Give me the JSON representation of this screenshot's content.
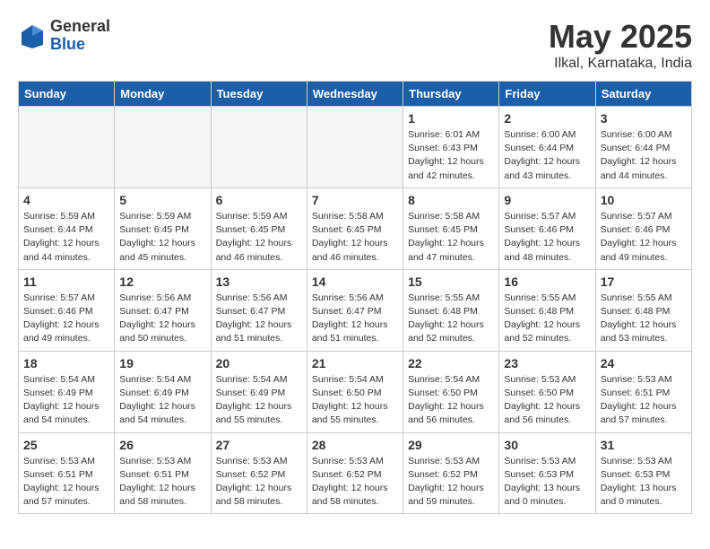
{
  "header": {
    "logo_general": "General",
    "logo_blue": "Blue",
    "month_year": "May 2025",
    "location": "Ilkal, Karnataka, India"
  },
  "days_of_week": [
    "Sunday",
    "Monday",
    "Tuesday",
    "Wednesday",
    "Thursday",
    "Friday",
    "Saturday"
  ],
  "weeks": [
    [
      {
        "day": "",
        "info": ""
      },
      {
        "day": "",
        "info": ""
      },
      {
        "day": "",
        "info": ""
      },
      {
        "day": "",
        "info": ""
      },
      {
        "day": "1",
        "info": "Sunrise: 6:01 AM\nSunset: 6:43 PM\nDaylight: 12 hours\nand 42 minutes."
      },
      {
        "day": "2",
        "info": "Sunrise: 6:00 AM\nSunset: 6:44 PM\nDaylight: 12 hours\nand 43 minutes."
      },
      {
        "day": "3",
        "info": "Sunrise: 6:00 AM\nSunset: 6:44 PM\nDaylight: 12 hours\nand 44 minutes."
      }
    ],
    [
      {
        "day": "4",
        "info": "Sunrise: 5:59 AM\nSunset: 6:44 PM\nDaylight: 12 hours\nand 44 minutes."
      },
      {
        "day": "5",
        "info": "Sunrise: 5:59 AM\nSunset: 6:45 PM\nDaylight: 12 hours\nand 45 minutes."
      },
      {
        "day": "6",
        "info": "Sunrise: 5:59 AM\nSunset: 6:45 PM\nDaylight: 12 hours\nand 46 minutes."
      },
      {
        "day": "7",
        "info": "Sunrise: 5:58 AM\nSunset: 6:45 PM\nDaylight: 12 hours\nand 46 minutes."
      },
      {
        "day": "8",
        "info": "Sunrise: 5:58 AM\nSunset: 6:45 PM\nDaylight: 12 hours\nand 47 minutes."
      },
      {
        "day": "9",
        "info": "Sunrise: 5:57 AM\nSunset: 6:46 PM\nDaylight: 12 hours\nand 48 minutes."
      },
      {
        "day": "10",
        "info": "Sunrise: 5:57 AM\nSunset: 6:46 PM\nDaylight: 12 hours\nand 49 minutes."
      }
    ],
    [
      {
        "day": "11",
        "info": "Sunrise: 5:57 AM\nSunset: 6:46 PM\nDaylight: 12 hours\nand 49 minutes."
      },
      {
        "day": "12",
        "info": "Sunrise: 5:56 AM\nSunset: 6:47 PM\nDaylight: 12 hours\nand 50 minutes."
      },
      {
        "day": "13",
        "info": "Sunrise: 5:56 AM\nSunset: 6:47 PM\nDaylight: 12 hours\nand 51 minutes."
      },
      {
        "day": "14",
        "info": "Sunrise: 5:56 AM\nSunset: 6:47 PM\nDaylight: 12 hours\nand 51 minutes."
      },
      {
        "day": "15",
        "info": "Sunrise: 5:55 AM\nSunset: 6:48 PM\nDaylight: 12 hours\nand 52 minutes."
      },
      {
        "day": "16",
        "info": "Sunrise: 5:55 AM\nSunset: 6:48 PM\nDaylight: 12 hours\nand 52 minutes."
      },
      {
        "day": "17",
        "info": "Sunrise: 5:55 AM\nSunset: 6:48 PM\nDaylight: 12 hours\nand 53 minutes."
      }
    ],
    [
      {
        "day": "18",
        "info": "Sunrise: 5:54 AM\nSunset: 6:49 PM\nDaylight: 12 hours\nand 54 minutes."
      },
      {
        "day": "19",
        "info": "Sunrise: 5:54 AM\nSunset: 6:49 PM\nDaylight: 12 hours\nand 54 minutes."
      },
      {
        "day": "20",
        "info": "Sunrise: 5:54 AM\nSunset: 6:49 PM\nDaylight: 12 hours\nand 55 minutes."
      },
      {
        "day": "21",
        "info": "Sunrise: 5:54 AM\nSunset: 6:50 PM\nDaylight: 12 hours\nand 55 minutes."
      },
      {
        "day": "22",
        "info": "Sunrise: 5:54 AM\nSunset: 6:50 PM\nDaylight: 12 hours\nand 56 minutes."
      },
      {
        "day": "23",
        "info": "Sunrise: 5:53 AM\nSunset: 6:50 PM\nDaylight: 12 hours\nand 56 minutes."
      },
      {
        "day": "24",
        "info": "Sunrise: 5:53 AM\nSunset: 6:51 PM\nDaylight: 12 hours\nand 57 minutes."
      }
    ],
    [
      {
        "day": "25",
        "info": "Sunrise: 5:53 AM\nSunset: 6:51 PM\nDaylight: 12 hours\nand 57 minutes."
      },
      {
        "day": "26",
        "info": "Sunrise: 5:53 AM\nSunset: 6:51 PM\nDaylight: 12 hours\nand 58 minutes."
      },
      {
        "day": "27",
        "info": "Sunrise: 5:53 AM\nSunset: 6:52 PM\nDaylight: 12 hours\nand 58 minutes."
      },
      {
        "day": "28",
        "info": "Sunrise: 5:53 AM\nSunset: 6:52 PM\nDaylight: 12 hours\nand 58 minutes."
      },
      {
        "day": "29",
        "info": "Sunrise: 5:53 AM\nSunset: 6:52 PM\nDaylight: 12 hours\nand 59 minutes."
      },
      {
        "day": "30",
        "info": "Sunrise: 5:53 AM\nSunset: 6:53 PM\nDaylight: 13 hours\nand 0 minutes."
      },
      {
        "day": "31",
        "info": "Sunrise: 5:53 AM\nSunset: 6:53 PM\nDaylight: 13 hours\nand 0 minutes."
      }
    ]
  ]
}
